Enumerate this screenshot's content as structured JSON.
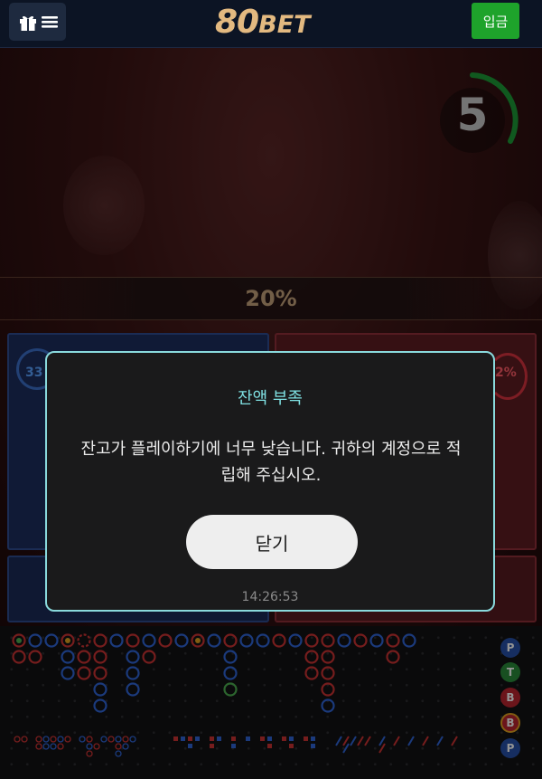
{
  "header": {
    "logo_big": "80",
    "logo_small": "BET",
    "deposit_label": "입금"
  },
  "game": {
    "timer": "5",
    "percent": "20%",
    "player_ring_text": "33",
    "banker_ring_text": "2%"
  },
  "modal": {
    "title": "잔액 부족",
    "message": "잔고가 플레이하기에 너무 낮습니다. 귀하의 계정으로 적립해 주십시오.",
    "close_label": "닫기",
    "time": "14:26:53"
  },
  "road_side": [
    "P",
    "T",
    "B",
    "B",
    "P"
  ],
  "colors": {
    "accent_cyan": "#7fe0e2",
    "deposit_green": "#1ea32b",
    "logo_gold": "#e3b980",
    "player_blue": "#3b6fc9",
    "banker_red": "#d7323f"
  }
}
